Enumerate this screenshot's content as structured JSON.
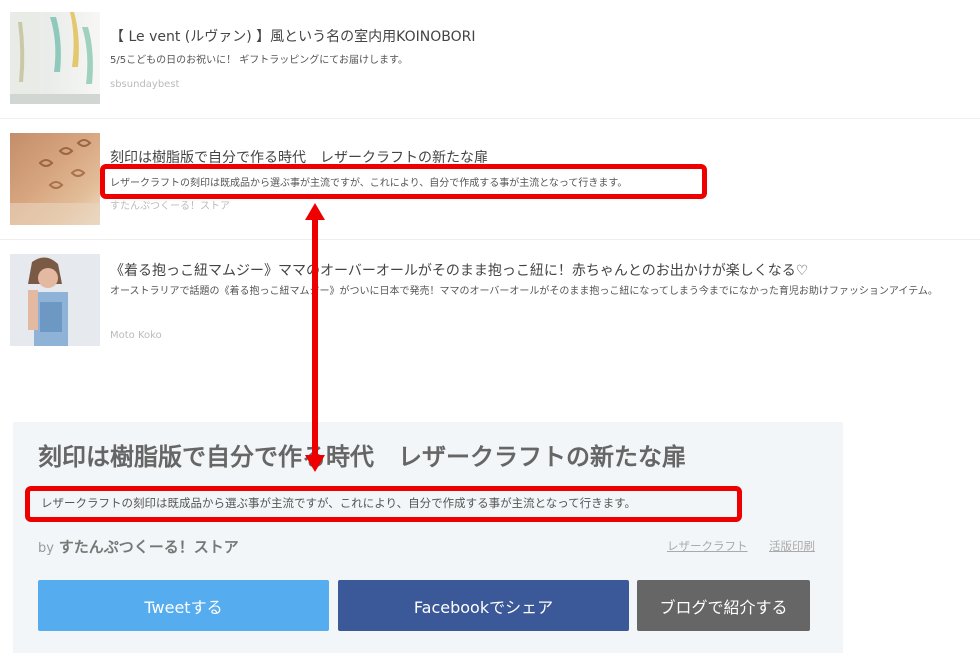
{
  "list": {
    "items": [
      {
        "title": "【 Le vent (ルヴァン) 】風という名の室内用KOINOBORI",
        "description": "5/5こどもの日のお祝いに！ ギフトラッピングにてお届けします。",
        "author": "sbsundaybest",
        "thumb_icon": "koinobori-photo"
      },
      {
        "title": "刻印は樹脂版で自分で作る時代　レザークラフトの新たな扉",
        "description": "レザークラフトの刻印は既成品から選ぶ事が主流ですが、これにより、自分で作成する事が主流となって行きます。",
        "author": "すたんぷつくーる！ストア",
        "thumb_icon": "leather-stamp-photo"
      },
      {
        "title": "《着る抱っこ紐マムジー》ママのオーバーオールがそのまま抱っこ紐に！赤ちゃんとのお出かけが楽しくなる♡",
        "description": "オーストラリアで話題の《着る抱っこ紐マムジー》がついに日本で発売！ママのオーバーオールがそのまま抱っこ紐になってしまう今までになかった育児お助けファッションアイテム。",
        "author": "Moto Koko",
        "thumb_icon": "mother-overalls-photo"
      }
    ]
  },
  "detail": {
    "title": "刻印は樹脂版で自分で作る時代　レザークラフトの新たな扉",
    "description": "レザークラフトの刻印は既成品から選ぶ事が主流ですが、これにより、自分で作成する事が主流となって行きます。",
    "by_prefix": "by",
    "author": "すたんぷつくーる！ストア",
    "tags": [
      "レザークラフト",
      "活版印刷"
    ],
    "buttons": {
      "tweet": "Tweetする",
      "facebook": "Facebookでシェア",
      "blog": "ブログで紹介する"
    }
  },
  "colors": {
    "highlight": "#ee0000",
    "twitter": "#55acee",
    "facebook": "#3b5998",
    "blog": "#666666",
    "panel_bg": "#f3f6f8"
  }
}
